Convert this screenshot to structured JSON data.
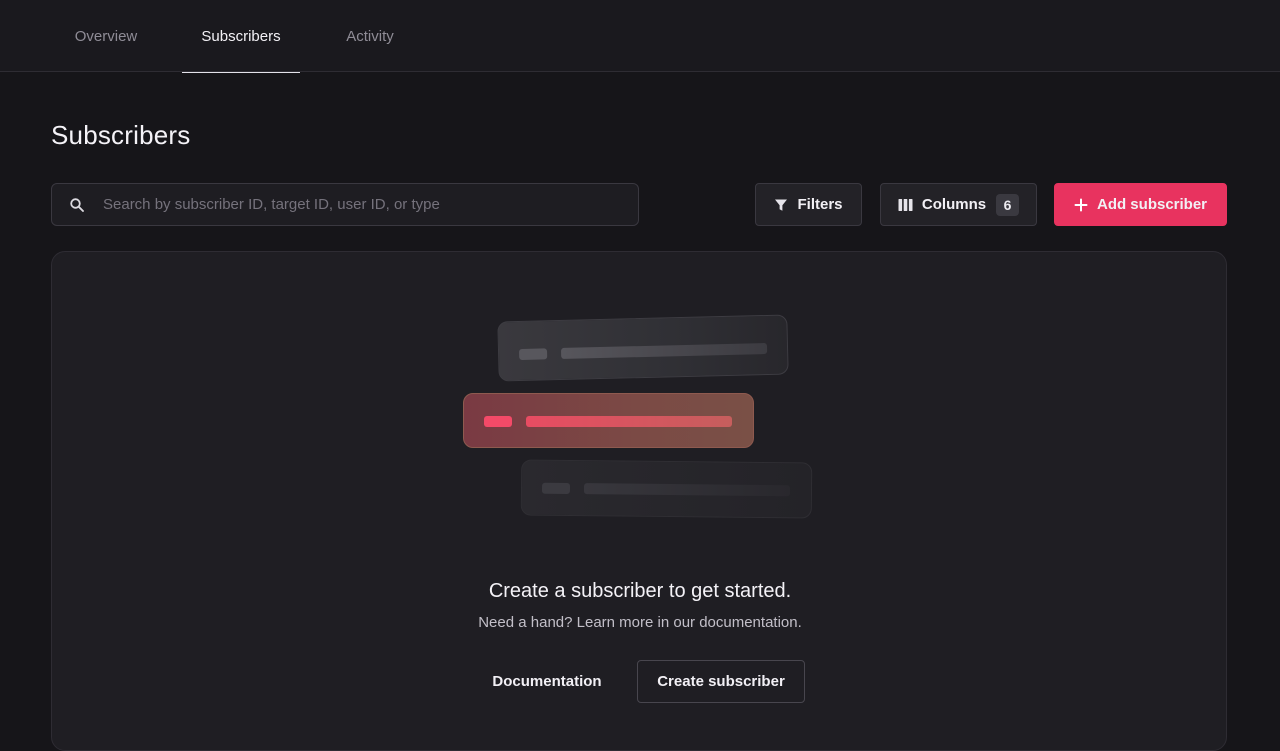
{
  "tabs": [
    {
      "label": "Overview",
      "active": false
    },
    {
      "label": "Subscribers",
      "active": true
    },
    {
      "label": "Activity",
      "active": false
    }
  ],
  "page": {
    "title": "Subscribers"
  },
  "search": {
    "placeholder": "Search by subscriber ID, target ID, user ID, or type",
    "value": "",
    "icon": "search-icon"
  },
  "toolbar": {
    "filters_label": "Filters",
    "filters_icon": "filter-icon",
    "columns_label": "Columns",
    "columns_icon": "columns-icon",
    "columns_count": "6",
    "add_label": "Add subscriber",
    "add_icon": "plus-icon"
  },
  "empty_state": {
    "title": "Create a subscriber to get started.",
    "subtitle": "Need a hand? Learn more in our documentation.",
    "docs_label": "Documentation",
    "create_label": "Create subscriber"
  },
  "colors": {
    "accent": "#e8335f",
    "background": "#161519",
    "panel": "#1f1e23"
  }
}
